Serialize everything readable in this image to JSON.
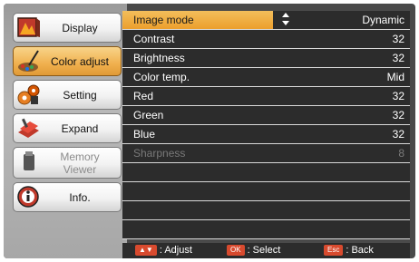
{
  "menu": {
    "items": [
      {
        "label": "Display",
        "icon": "display-icon",
        "state": "normal"
      },
      {
        "label": "Color adjust",
        "icon": "color-adjust-icon",
        "state": "active"
      },
      {
        "label": "Setting",
        "icon": "setting-icon",
        "state": "normal"
      },
      {
        "label": "Expand",
        "icon": "expand-icon",
        "state": "normal"
      },
      {
        "label": "Memory\nViewer",
        "icon": "memory-viewer-icon",
        "state": "disabled"
      },
      {
        "label": "Info.",
        "icon": "info-icon",
        "state": "normal"
      }
    ]
  },
  "settings": {
    "rows": [
      {
        "name": "Image mode",
        "value": "Dynamic",
        "selected": true
      },
      {
        "name": "Contrast",
        "value": "32"
      },
      {
        "name": "Brightness",
        "value": "32"
      },
      {
        "name": "Color temp.",
        "value": "Mid"
      },
      {
        "name": "Red",
        "value": "32"
      },
      {
        "name": "Green",
        "value": "32"
      },
      {
        "name": "Blue",
        "value": "32"
      },
      {
        "name": "Sharpness",
        "value": "8",
        "disabled": true
      }
    ]
  },
  "hints": {
    "adjust_key": "▲▼",
    "adjust_label": ": Adjust",
    "select_key": "OK",
    "select_label": ": Select",
    "back_key": "Esc",
    "back_label": ": Back"
  },
  "colors": {
    "highlight": "#ec9f2c",
    "active_menu": "#f0b04e",
    "panel": "#2c2c2c",
    "key_badge": "#d84a2e"
  }
}
